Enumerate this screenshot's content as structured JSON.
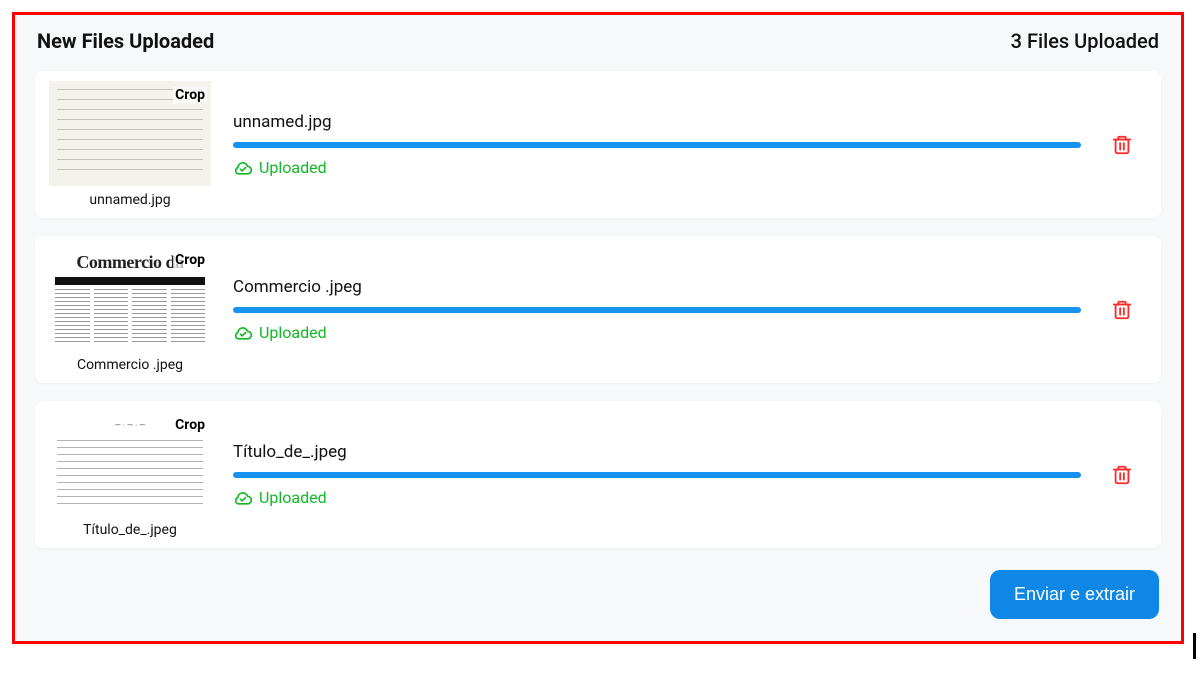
{
  "header": {
    "title": "New Files Uploaded",
    "count_label": "3 Files Uploaded"
  },
  "files": [
    {
      "name": "unnamed.jpg",
      "thumb_name": "unnamed.jpg",
      "crop_label": "Crop",
      "status": "Uploaded",
      "progress": 100,
      "thumb_kind": "script"
    },
    {
      "name": "Commercio .jpeg",
      "thumb_name": "Commercio .jpeg",
      "crop_label": "Crop",
      "status": "Uploaded",
      "progress": 100,
      "thumb_kind": "newspaper",
      "newspaper_head": "Commercio da"
    },
    {
      "name": "Título_de_.jpeg",
      "thumb_name": "Título_de_.jpeg",
      "crop_label": "Crop",
      "status": "Uploaded",
      "progress": 100,
      "thumb_kind": "doc"
    }
  ],
  "submit_label": "Enviar e extrair",
  "colors": {
    "progress": "#1693f0",
    "success": "#12b928",
    "danger": "#ff2a2a",
    "primary": "#0f87e6"
  }
}
